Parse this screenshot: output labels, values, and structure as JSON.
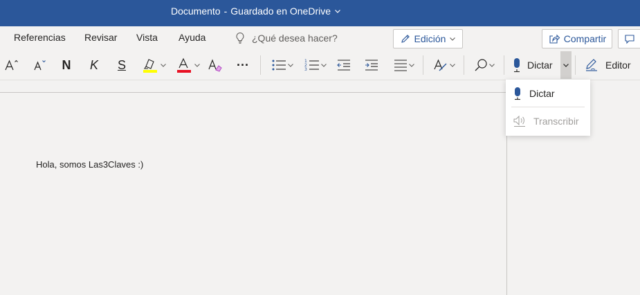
{
  "titlebar": {
    "doc_name": "Documento",
    "separator": "-",
    "save_status": "Guardado en OneDrive"
  },
  "tabs": [
    {
      "label": "Referencias"
    },
    {
      "label": "Revisar"
    },
    {
      "label": "Vista"
    },
    {
      "label": "Ayuda"
    }
  ],
  "tell_me": {
    "placeholder": "¿Qué desea hacer?"
  },
  "editing_mode": {
    "label": "Edición"
  },
  "share": {
    "label": "Compartir"
  },
  "ribbon": {
    "bold_glyph": "N",
    "italic_glyph": "K",
    "strike_glyph": "S",
    "highlight_color": "#ffff00",
    "font_color": "#e81123",
    "more_glyph": "···",
    "dictate_label": "Dictar",
    "editor_label": "Editor"
  },
  "dictate_menu": {
    "items": [
      {
        "label": "Dictar",
        "enabled": true
      },
      {
        "label": "Transcribir",
        "enabled": false
      }
    ]
  },
  "document": {
    "body_text": "Hola, somos Las3Claves :)"
  },
  "colors": {
    "accent": "#2b579a",
    "titlebar": "#2b579a",
    "background": "#f3f2f1",
    "disabled_text": "#a19f9d"
  }
}
